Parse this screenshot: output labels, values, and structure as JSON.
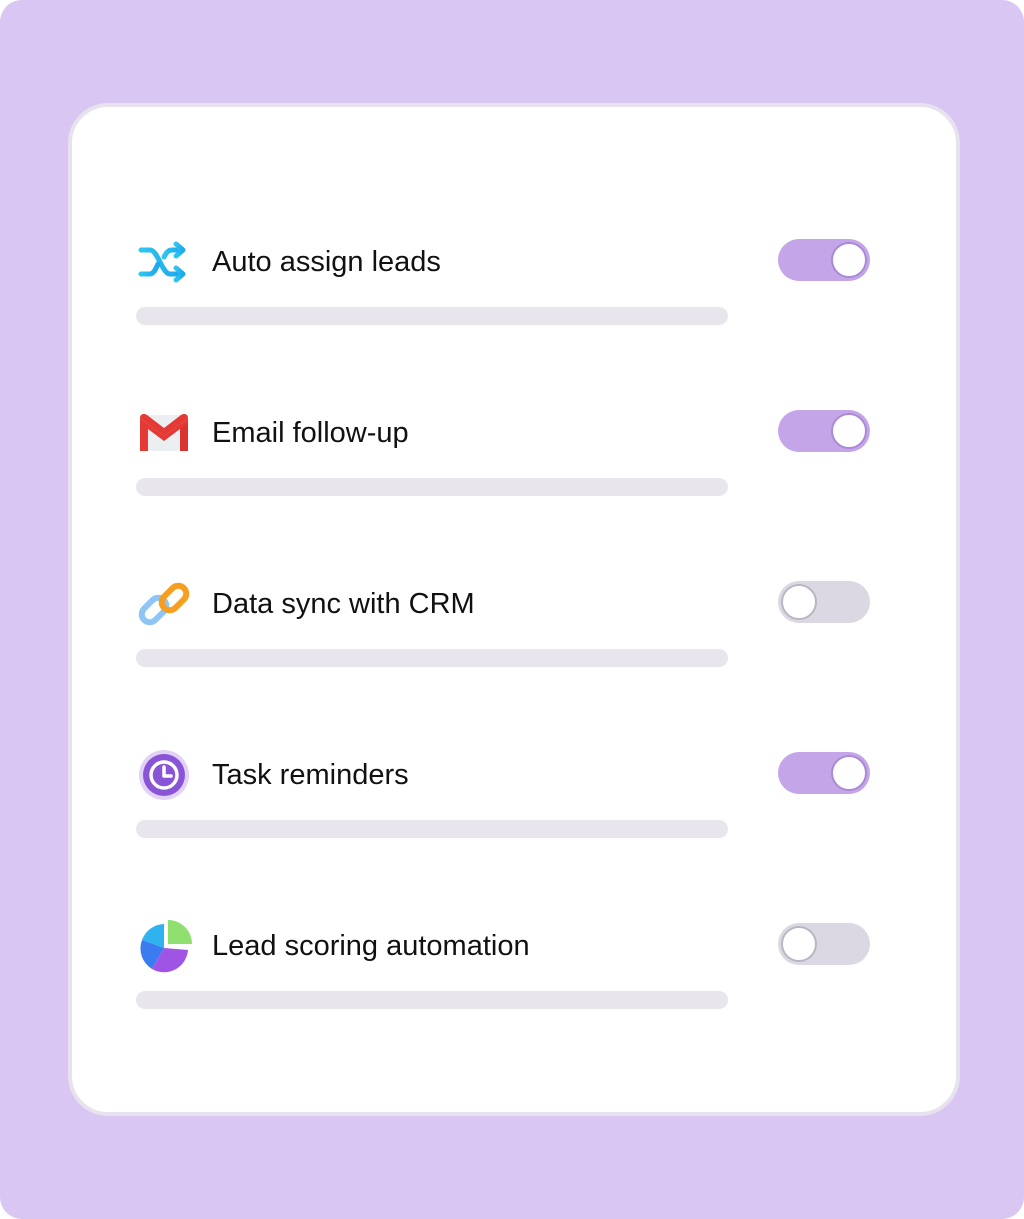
{
  "settings": {
    "items": [
      {
        "label": "Auto assign leads",
        "icon": "shuffle-icon",
        "enabled": true
      },
      {
        "label": "Email follow-up",
        "icon": "gmail-icon",
        "enabled": true
      },
      {
        "label": "Data sync with CRM",
        "icon": "link-icon",
        "enabled": false
      },
      {
        "label": "Task reminders",
        "icon": "clock-icon",
        "enabled": true
      },
      {
        "label": "Lead scoring automation",
        "icon": "pie-chart-icon",
        "enabled": false
      }
    ]
  },
  "colors": {
    "background": "#d9c6f2",
    "toggle_on": "#c4a5e8",
    "toggle_off": "#dcd8e3",
    "placeholder_bar": "#e8e6ec"
  }
}
